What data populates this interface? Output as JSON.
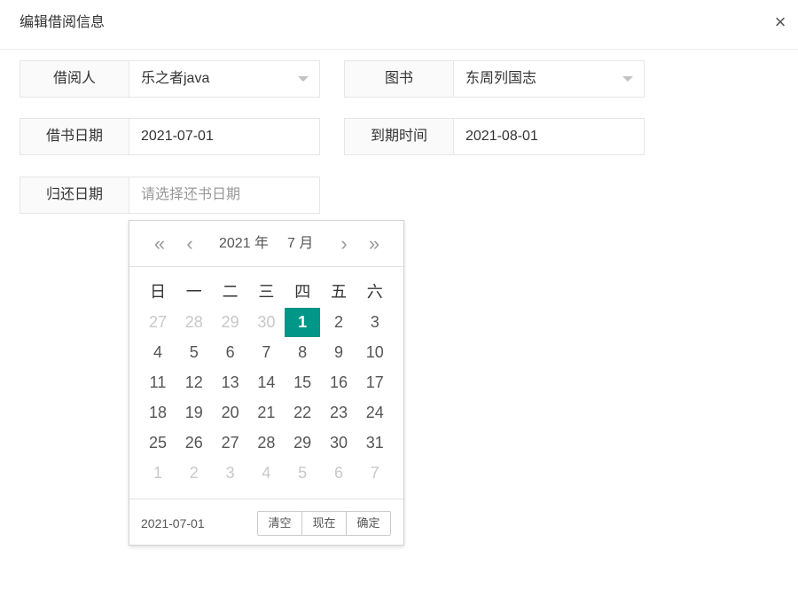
{
  "dialog": {
    "title": "编辑借阅信息",
    "close_icon": "×"
  },
  "form": {
    "borrower": {
      "label": "借阅人",
      "value": "乐之者java"
    },
    "book": {
      "label": "图书",
      "value": "东周列国志"
    },
    "borrow_date": {
      "label": "借书日期",
      "value": "2021-07-01"
    },
    "due_date": {
      "label": "到期时间",
      "value": "2021-08-01"
    },
    "return_date": {
      "label": "归还日期",
      "placeholder": "请选择还书日期"
    }
  },
  "datepicker": {
    "prev_year_icon": "«",
    "prev_month_icon": "‹",
    "next_month_icon": "›",
    "next_year_icon": "»",
    "year_label": "2021 年",
    "month_label": "7 月",
    "weekdays": [
      "日",
      "一",
      "二",
      "三",
      "四",
      "五",
      "六"
    ],
    "weeks": [
      [
        {
          "d": "27",
          "o": true
        },
        {
          "d": "28",
          "o": true
        },
        {
          "d": "29",
          "o": true
        },
        {
          "d": "30",
          "o": true
        },
        {
          "d": "1",
          "s": true
        },
        {
          "d": "2"
        },
        {
          "d": "3"
        }
      ],
      [
        {
          "d": "4"
        },
        {
          "d": "5"
        },
        {
          "d": "6"
        },
        {
          "d": "7"
        },
        {
          "d": "8"
        },
        {
          "d": "9"
        },
        {
          "d": "10"
        }
      ],
      [
        {
          "d": "11"
        },
        {
          "d": "12"
        },
        {
          "d": "13"
        },
        {
          "d": "14"
        },
        {
          "d": "15"
        },
        {
          "d": "16"
        },
        {
          "d": "17"
        }
      ],
      [
        {
          "d": "18"
        },
        {
          "d": "19"
        },
        {
          "d": "20"
        },
        {
          "d": "21"
        },
        {
          "d": "22"
        },
        {
          "d": "23"
        },
        {
          "d": "24"
        }
      ],
      [
        {
          "d": "25"
        },
        {
          "d": "26"
        },
        {
          "d": "27"
        },
        {
          "d": "28"
        },
        {
          "d": "29"
        },
        {
          "d": "30"
        },
        {
          "d": "31"
        }
      ],
      [
        {
          "d": "1",
          "o": true
        },
        {
          "d": "2",
          "o": true
        },
        {
          "d": "3",
          "o": true
        },
        {
          "d": "4",
          "o": true
        },
        {
          "d": "5",
          "o": true
        },
        {
          "d": "6",
          "o": true
        },
        {
          "d": "7",
          "o": true
        }
      ]
    ],
    "footer_date": "2021-07-01",
    "buttons": {
      "clear": "清空",
      "now": "现在",
      "confirm": "确定"
    },
    "accent_color": "#009688"
  }
}
